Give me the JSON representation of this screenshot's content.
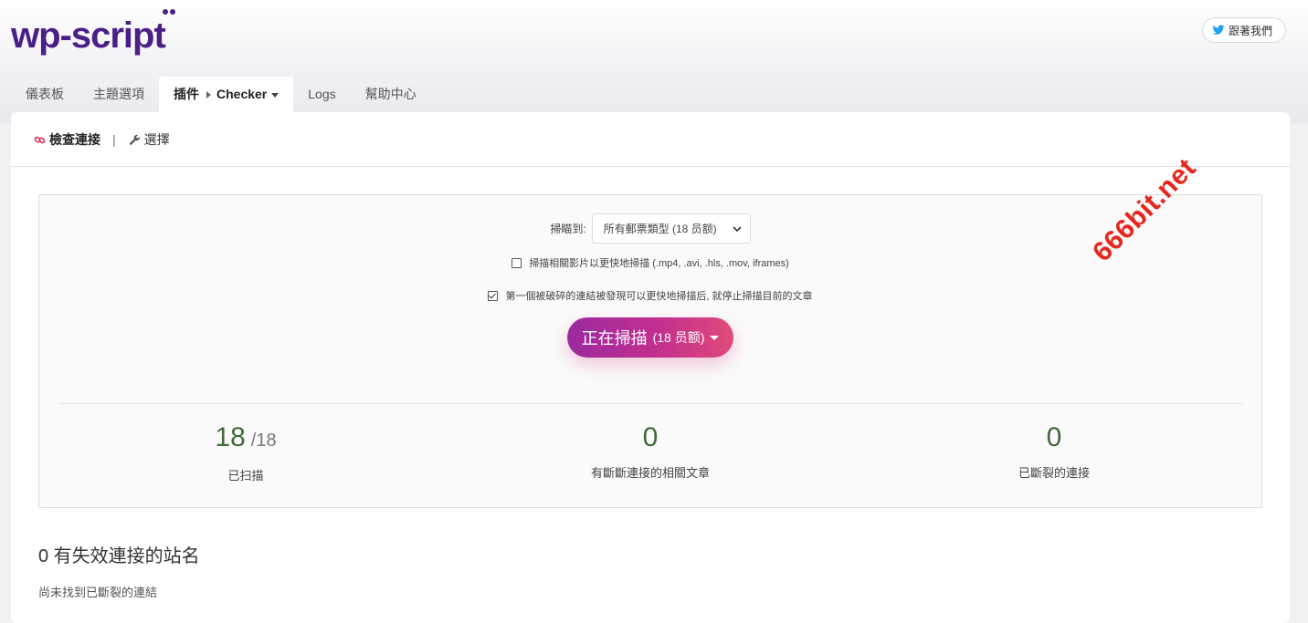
{
  "header": {
    "logo_text": "wp-script",
    "twitter_label": "跟著我們"
  },
  "tabs": [
    {
      "label": "儀表板"
    },
    {
      "label": "主題選項"
    },
    {
      "label": "插件",
      "sub": "Checker",
      "active": true
    },
    {
      "label": "Logs"
    },
    {
      "label": "幫助中心"
    }
  ],
  "subnav": {
    "check_links": "檢查連接",
    "separator": "|",
    "options": "選擇"
  },
  "scan": {
    "scan_label": "掃瞄到:",
    "select_value": "所有郵票類型 (18 员额)",
    "option_videos": "掃描相關影片以更快地掃描 (.mp4, .avi, .hls, .mov, iframes)",
    "option_videos_checked": false,
    "option_stop": "第一個被破碎的連結被發現可以更快地掃描后, 就停止掃描目前的文章",
    "option_stop_checked": true,
    "button_main": "正在掃描",
    "button_count": "(18 员额)"
  },
  "stats": {
    "scanned": "18",
    "scanned_total": "/18",
    "scanned_label": "已扫描",
    "posts_broken": "0",
    "posts_broken_label": "有斷斷連接的相關文章",
    "broken_links": "0",
    "broken_links_label": "已斷裂的連接"
  },
  "results": {
    "title": "0 有失效連接的站名",
    "empty": "尚未找到已斷裂的連結"
  },
  "watermark": "666bit.net",
  "colors": {
    "logo": "#4a1f87",
    "accent_start": "#9b2aa0",
    "accent_end": "#e04a7a",
    "stat_number": "#3f6b36",
    "watermark": "#e8261d"
  }
}
